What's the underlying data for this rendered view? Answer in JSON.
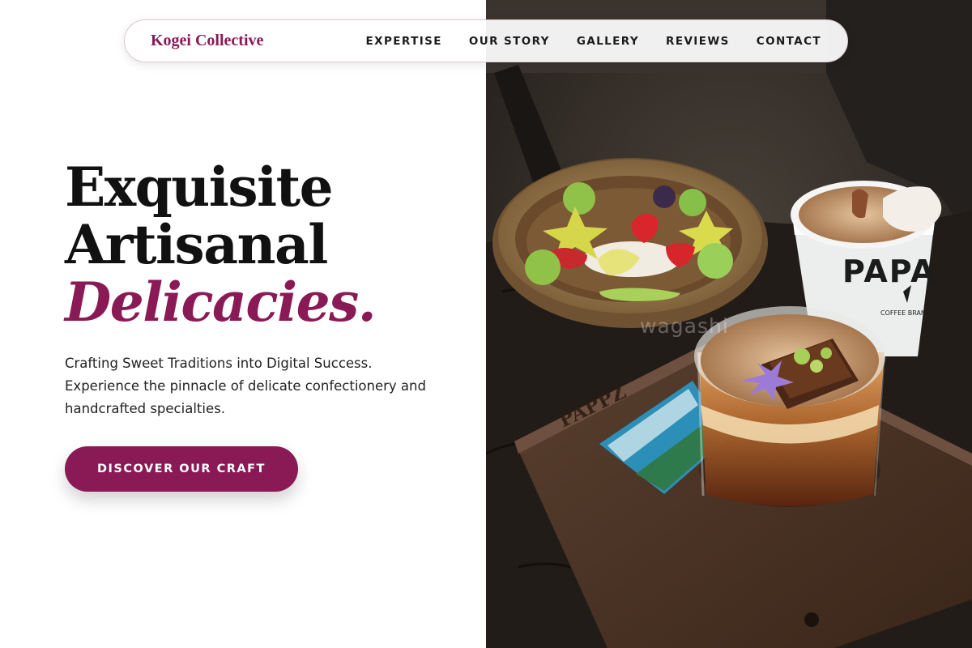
{
  "nav": {
    "brand": "Kogei Collective",
    "items": [
      "EXPERTISE",
      "OUR STORY",
      "GALLERY",
      "REVIEWS",
      "CONTACT"
    ]
  },
  "hero": {
    "line1": "Exquisite",
    "line2": "Artisanal",
    "line3": "Delicacies.",
    "subtitle": "Crafting Sweet Traditions into Digital Success. Experience the pinnacle of delicate confectionery and handcrafted specialties.",
    "cta": "DISCOVER OUR CRAFT"
  },
  "photo": {
    "watermark": "wagashi",
    "cup_brand": "PAPA",
    "cup_sub": "COFFEE BRAND",
    "tray_brand": "PAPPZ"
  },
  "colors": {
    "accent": "#8a1a55",
    "text": "#111111"
  }
}
